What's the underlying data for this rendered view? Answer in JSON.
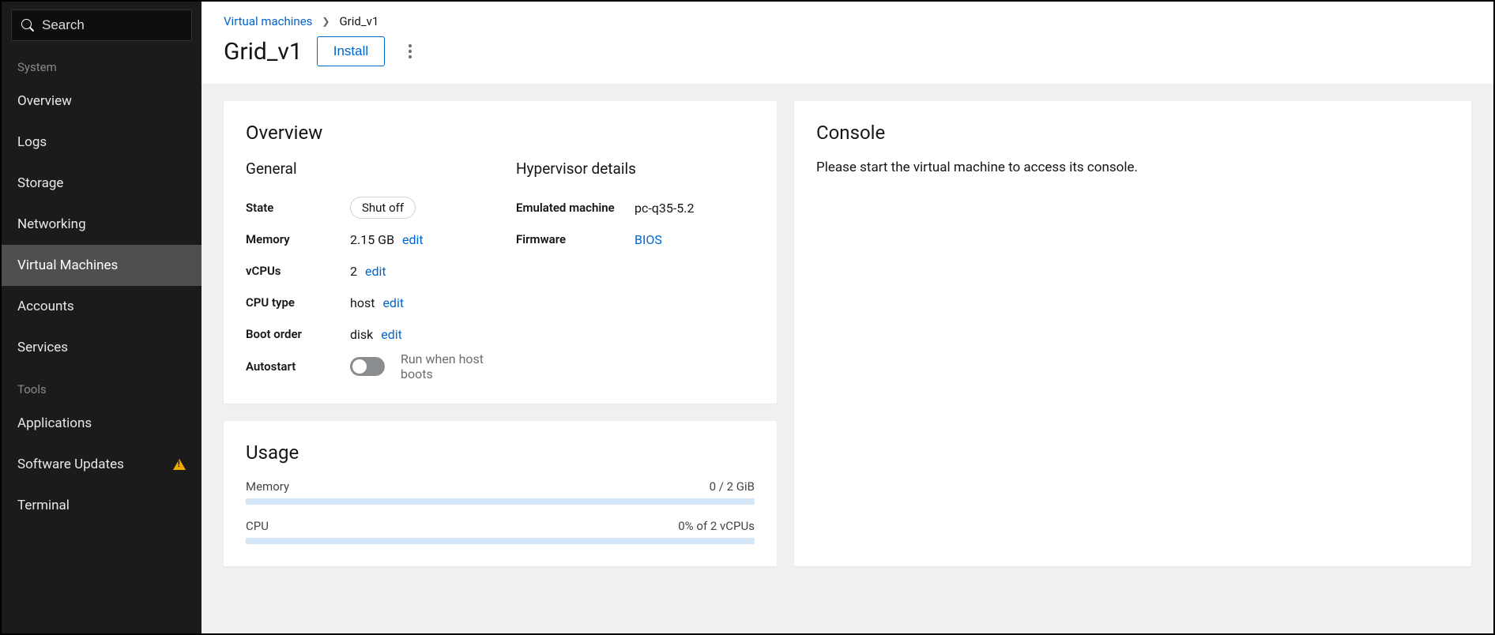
{
  "search": {
    "placeholder": "Search"
  },
  "sidebar": {
    "section1_label": "System",
    "section2_label": "Tools",
    "system_items": [
      {
        "label": "Overview",
        "active": false
      },
      {
        "label": "Logs",
        "active": false
      },
      {
        "label": "Storage",
        "active": false
      },
      {
        "label": "Networking",
        "active": false
      },
      {
        "label": "Virtual Machines",
        "active": true
      },
      {
        "label": "Accounts",
        "active": false
      },
      {
        "label": "Services",
        "active": false
      }
    ],
    "tools_items": [
      {
        "label": "Applications",
        "warn": false
      },
      {
        "label": "Software Updates",
        "warn": true
      },
      {
        "label": "Terminal",
        "warn": false
      }
    ]
  },
  "breadcrumb": {
    "root": "Virtual machines",
    "current": "Grid_v1"
  },
  "page_title": "Grid_v1",
  "install_label": "Install",
  "overview": {
    "title": "Overview",
    "general_title": "General",
    "hypervisor_title": "Hypervisor details",
    "labels": {
      "state": "State",
      "memory": "Memory",
      "vcpus": "vCPUs",
      "cpu_type": "CPU type",
      "boot_order": "Boot order",
      "autostart": "Autostart",
      "emulated": "Emulated machine",
      "firmware": "Firmware"
    },
    "values": {
      "state": "Shut off",
      "memory": "2.15 GB",
      "vcpus": "2",
      "cpu_type": "host",
      "boot_order": "disk",
      "autostart_label": "Run when host boots",
      "emulated": "pc-q35-5.2",
      "firmware": "BIOS"
    },
    "edit_label": "edit"
  },
  "usage": {
    "title": "Usage",
    "memory_label": "Memory",
    "memory_value": "0 / 2 GiB",
    "cpu_label": "CPU",
    "cpu_value": "0% of 2 vCPUs"
  },
  "console": {
    "title": "Console",
    "message": "Please start the virtual machine to access its console."
  }
}
